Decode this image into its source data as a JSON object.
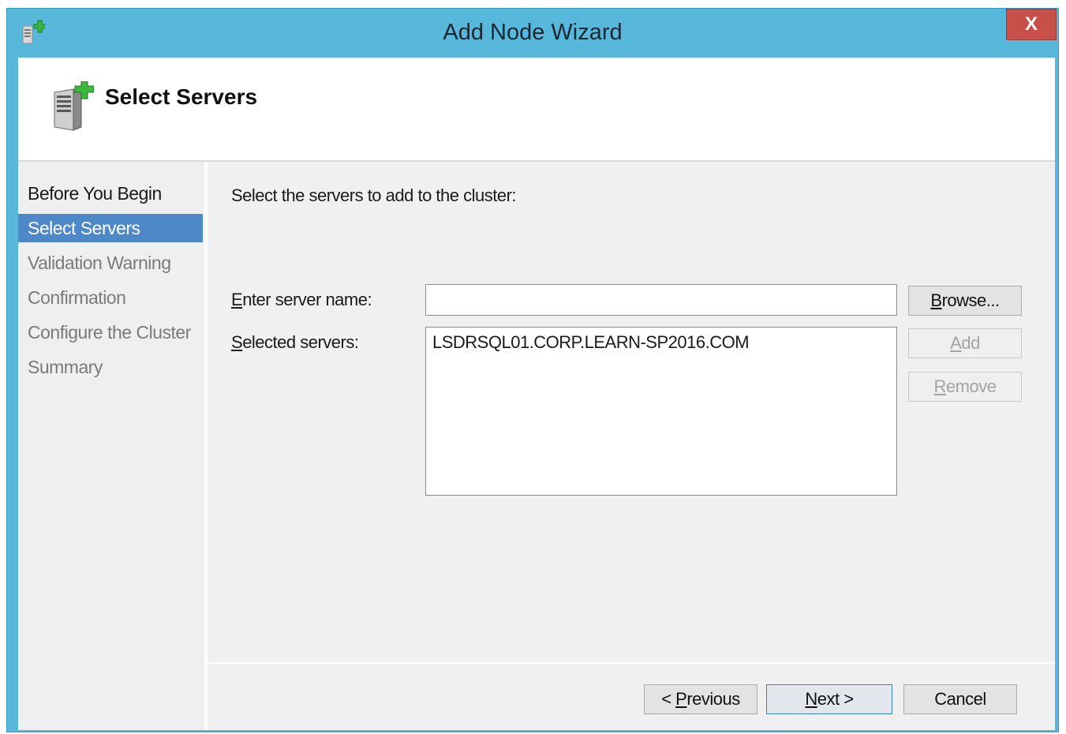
{
  "window": {
    "title": "Add Node Wizard",
    "close_label": "X"
  },
  "header": {
    "title": "Select Servers"
  },
  "steps": [
    {
      "label": "Before You Begin",
      "state": "done"
    },
    {
      "label": "Select Servers",
      "state": "active"
    },
    {
      "label": "Validation Warning",
      "state": "pending"
    },
    {
      "label": "Confirmation",
      "state": "pending"
    },
    {
      "label": "Configure the Cluster",
      "state": "pending"
    },
    {
      "label": "Summary",
      "state": "pending"
    }
  ],
  "main": {
    "prompt": "Select the servers to add to the cluster:",
    "server_name_label_mnemonic": "E",
    "server_name_label_rest": "nter server name:",
    "server_name_value": "",
    "selected_label_mnemonic": "S",
    "selected_label_rest": "elected servers:",
    "selected_servers": [
      "LSDRSQL01.CORP.LEARN-SP2016.COM"
    ],
    "browse_mnemonic": "B",
    "browse_rest": "rowse...",
    "add_mnemonic": "A",
    "add_rest": "dd",
    "remove_mnemonic": "R",
    "remove_rest": "emove"
  },
  "footer": {
    "previous_prefix": "< ",
    "previous_mnemonic": "P",
    "previous_rest": "revious",
    "next_mnemonic": "N",
    "next_rest": "ext >",
    "cancel_label": "Cancel"
  },
  "colors": {
    "titlebar": "#58b8dc",
    "close_button": "#c7504a",
    "active_step": "#4d88c8"
  },
  "icons": {
    "title": "server-add-icon",
    "header": "server-add-icon"
  }
}
